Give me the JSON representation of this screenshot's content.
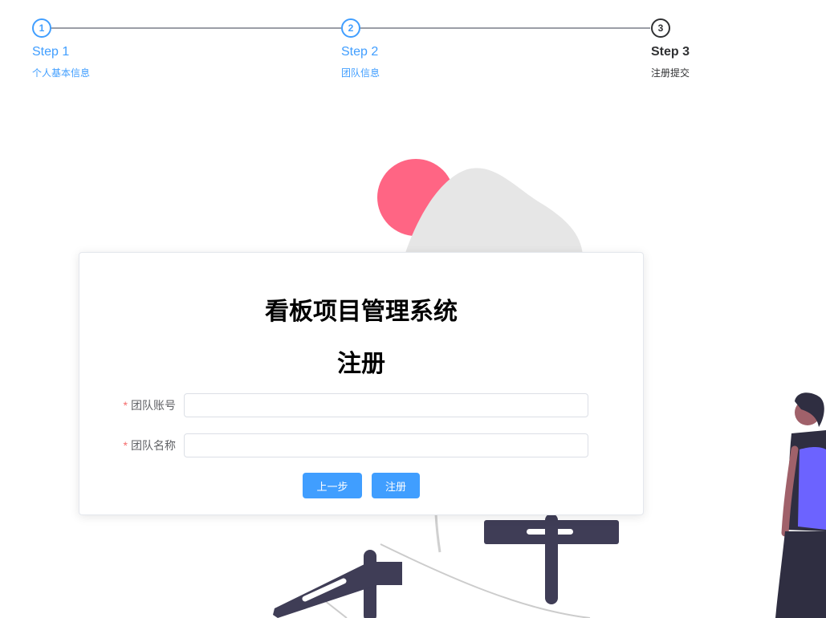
{
  "steps": [
    {
      "title": "Step 1",
      "description": "个人基本信息",
      "number": "1",
      "status": "finished"
    },
    {
      "title": "Step 2",
      "description": "团队信息",
      "number": "2",
      "status": "finished"
    },
    {
      "title": "Step 3",
      "description": "注册提交",
      "number": "3",
      "status": "current"
    }
  ],
  "card": {
    "app_title": "看板项目管理系统",
    "form_title": "注册"
  },
  "form": {
    "fields": [
      {
        "label": "团队账号",
        "required_mark": "*",
        "value": "",
        "placeholder": ""
      },
      {
        "label": "团队名称",
        "required_mark": "*",
        "value": "",
        "placeholder": ""
      }
    ],
    "prev_button": "上一步",
    "submit_button": "注册"
  },
  "colors": {
    "primary": "#409eff",
    "current_step": "#303133",
    "required": "#f56c6c",
    "illustration_pink": "#ff6584",
    "illustration_dark": "#3f3d56",
    "illustration_purple": "#6c63ff"
  }
}
